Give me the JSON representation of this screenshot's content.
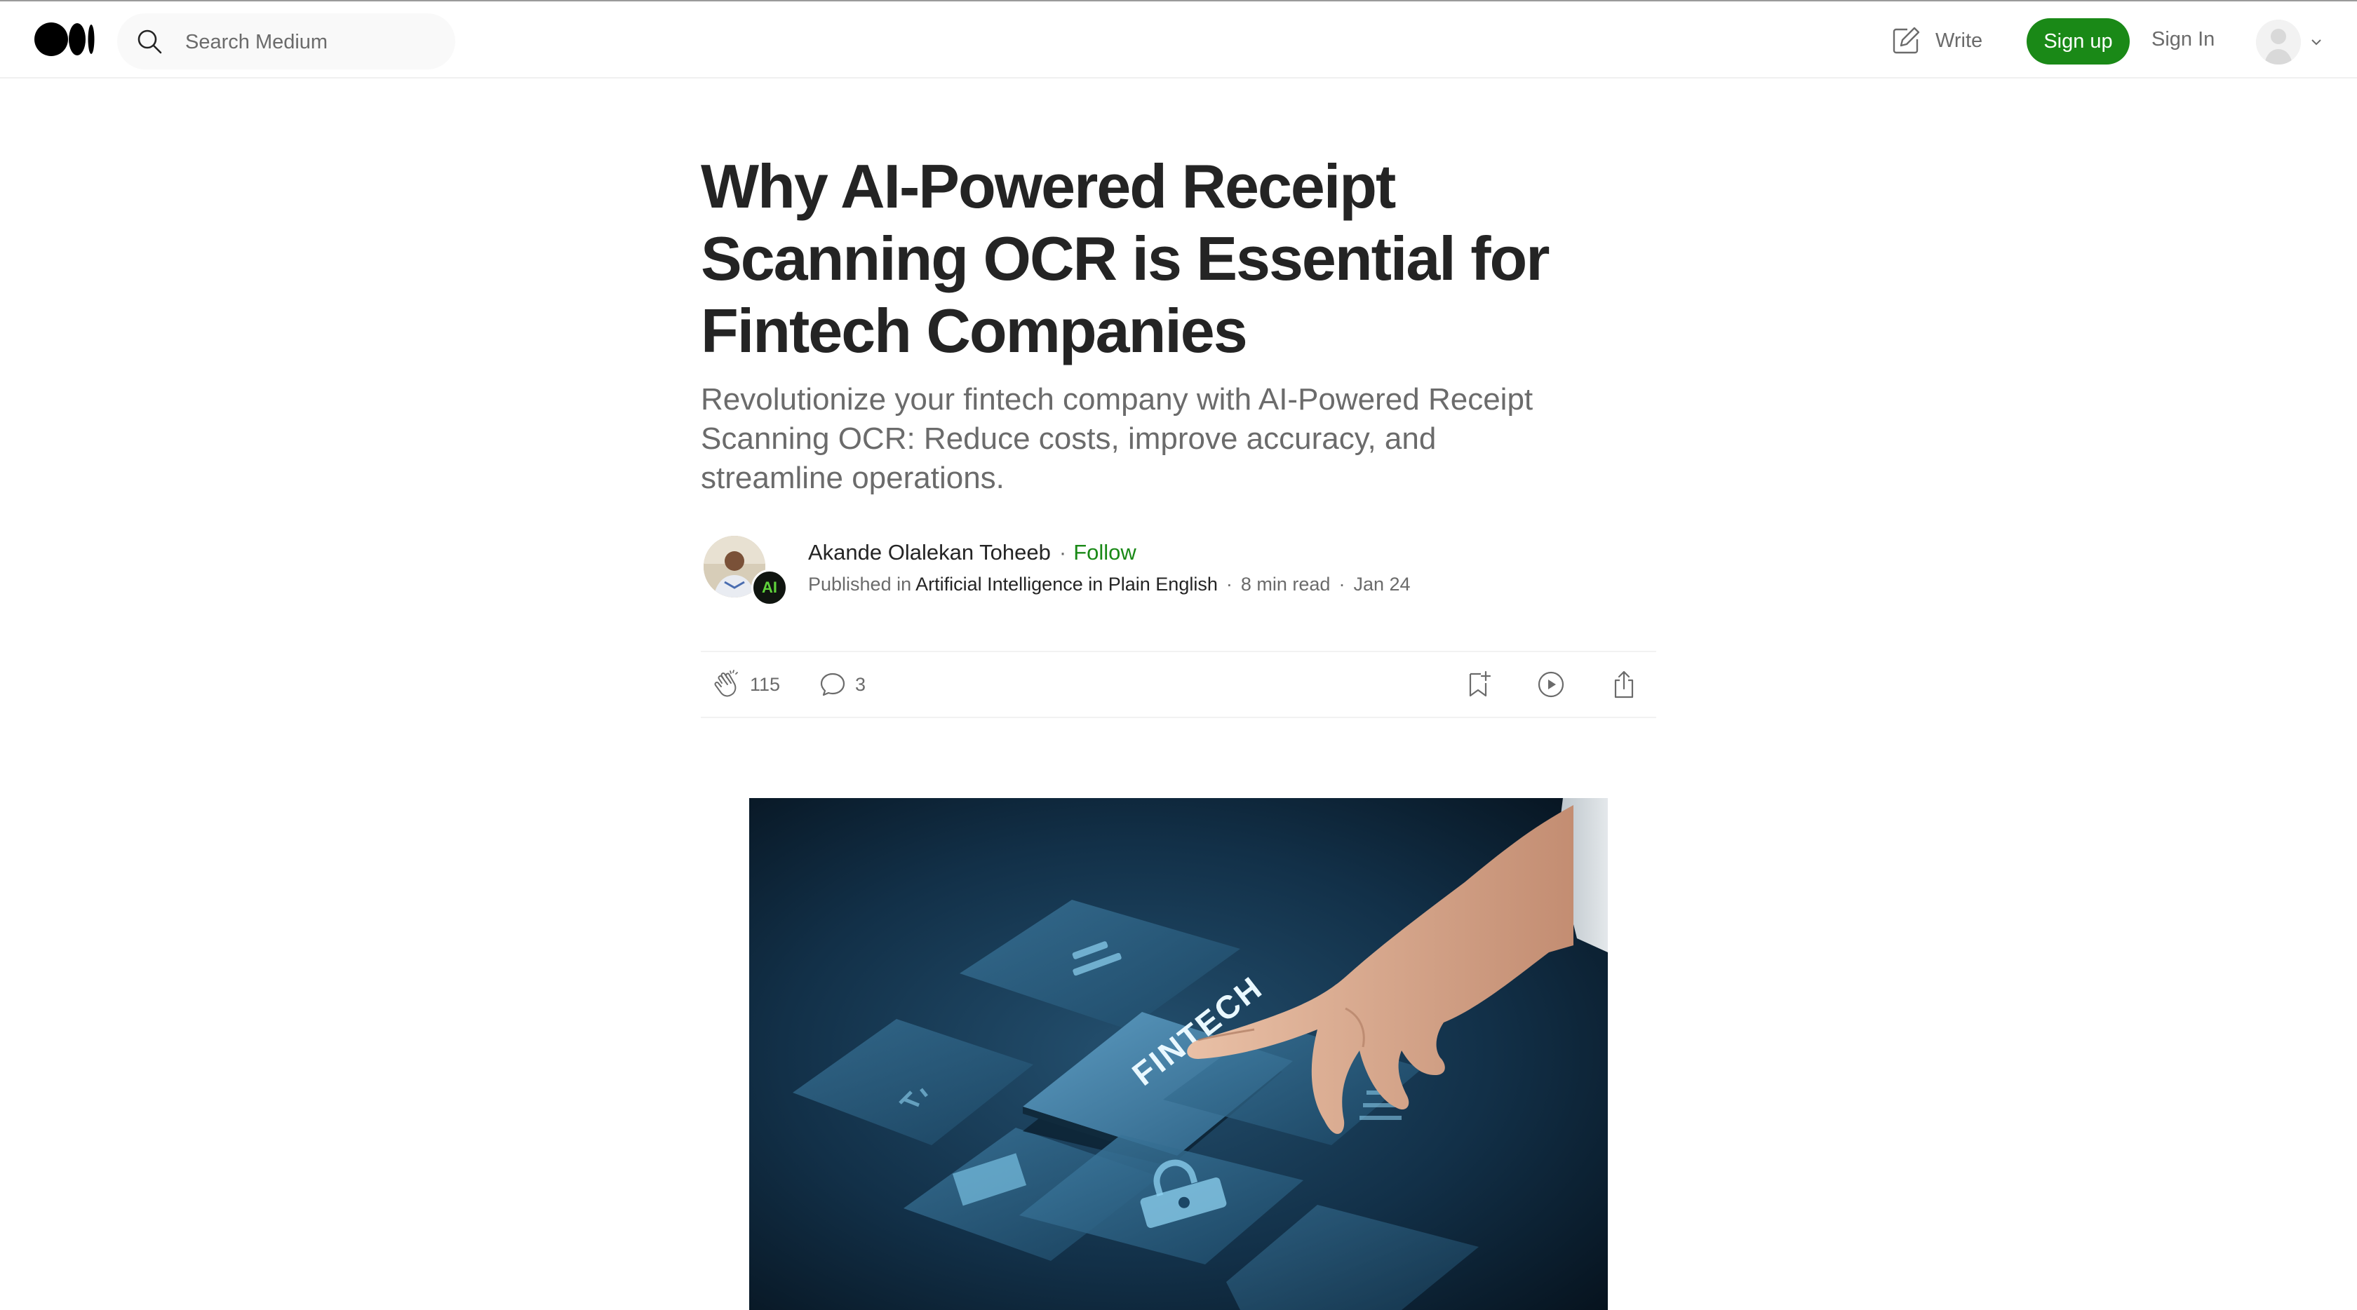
{
  "topbar": {
    "logo_icon": "medium-logo-icon",
    "search": {
      "placeholder": "Search Medium",
      "value": "",
      "icon": "search-icon"
    },
    "write": {
      "label": "Write",
      "icon": "write-icon"
    },
    "signup_label": "Sign up",
    "signin_label": "Sign In",
    "avatar_icon": "user-avatar-icon",
    "chevron_icon": "chevron-down-icon"
  },
  "article": {
    "title": "Why AI-Powered Receipt Scanning OCR is Essential for Fintech Companies",
    "subtitle": "Revolutionize your fintech company with AI-Powered Receipt Scanning OCR: Reduce costs, improve accuracy, and streamline operations.",
    "author": {
      "name": "Akande Olalekan Toheeb",
      "separator": "·",
      "follow_label": "Follow"
    },
    "publication": {
      "prefix": "Published in",
      "name": "Artificial Intelligence in Plain English",
      "badge_text": "AI"
    },
    "meta": {
      "read_time": "8 min read",
      "date": "Jan 24",
      "separator": "·"
    },
    "actions": {
      "claps": "115",
      "responses": "3",
      "icons": [
        "clap-icon",
        "comment-icon",
        "bookmark-add-icon",
        "play-icon",
        "share-icon"
      ]
    },
    "hero_image": {
      "tile_text": "FINTECH",
      "description_icon": "fintech-hero-image"
    }
  },
  "colors": {
    "brand_green": "#1a8917",
    "text_primary": "#242424",
    "text_secondary": "#6b6b6b",
    "hero_bg": "#0b1c2c",
    "badge_green": "#5fd33b"
  }
}
